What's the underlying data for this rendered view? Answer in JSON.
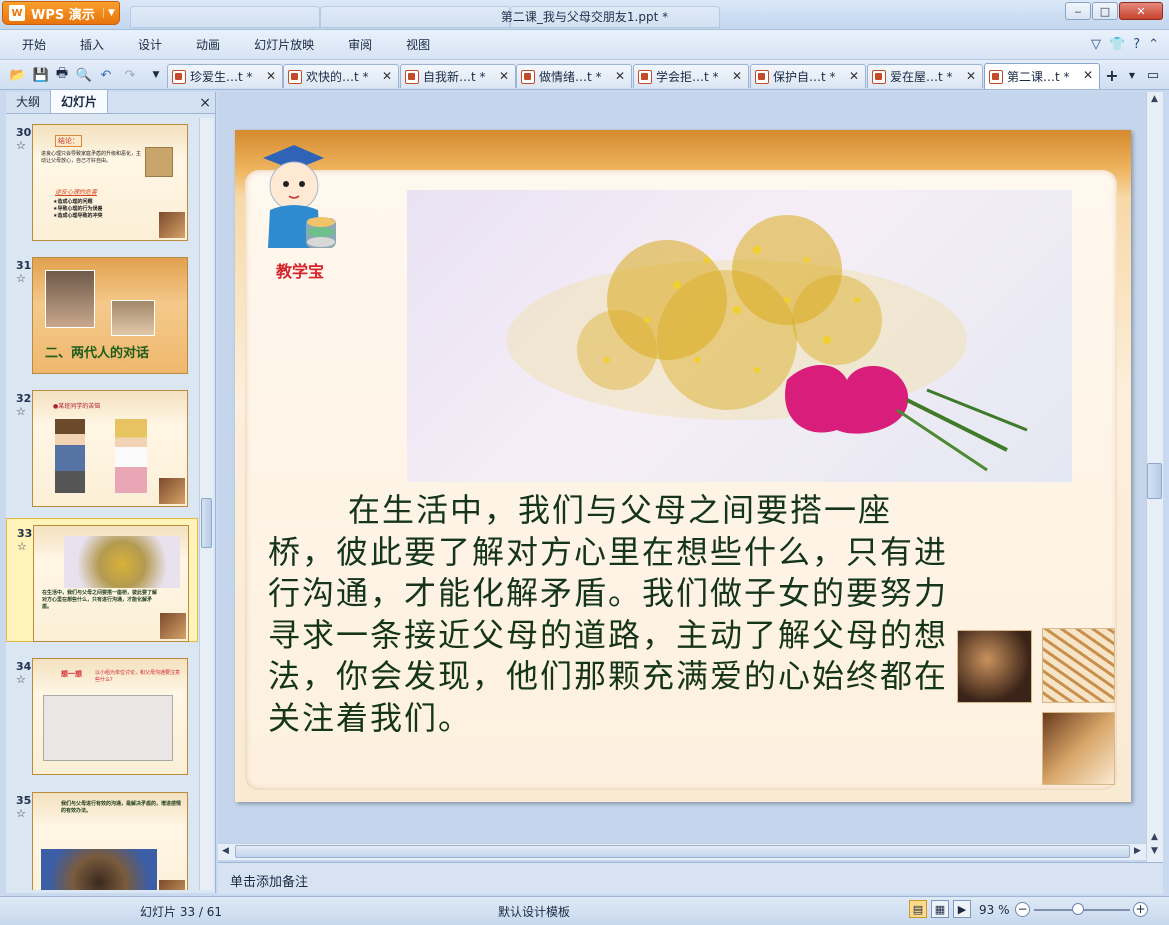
{
  "app": {
    "name": "WPS 演示",
    "document_title": "第二课_我与父母交朋友1.ppt *"
  },
  "menu": [
    "开始",
    "插入",
    "设计",
    "动画",
    "幻灯片放映",
    "审阅",
    "视图"
  ],
  "doc_tabs": [
    {
      "label": "珍爱生…t *",
      "active": false
    },
    {
      "label": "欢快的…t *",
      "active": false
    },
    {
      "label": "自我新…t *",
      "active": false
    },
    {
      "label": "做情绪…t *",
      "active": false
    },
    {
      "label": "学会拒…t *",
      "active": false
    },
    {
      "label": "保护自…t *",
      "active": false
    },
    {
      "label": "爱在屋…t *",
      "active": false
    },
    {
      "label": "第二课…t *",
      "active": true
    }
  ],
  "pane": {
    "tab_outline": "大纲",
    "tab_slides": "幻灯片",
    "close": "×"
  },
  "thumbnails": [
    {
      "num": "30",
      "star": "☆",
      "title": "结论：",
      "text": "进良心理只会导致家庭矛盾的升级和恶化，主动让父母放心，自己才好自由。",
      "sub": "逆反心理的危害",
      "bullets": [
        "★造成心理的问题",
        "★导致心理的行为误差",
        "★造成心理导致的冲突"
      ]
    },
    {
      "num": "31",
      "star": "☆",
      "title": "二、两代人的对话"
    },
    {
      "num": "32",
      "star": "☆",
      "title": "●某班同学的苦恼"
    },
    {
      "num": "33",
      "star": "☆",
      "text": "在生活中，我们与父母之间要搭一座桥，彼此要了解对方心里在想些什么，只有进行沟通，才能化解矛盾。"
    },
    {
      "num": "34",
      "star": "☆",
      "title": "想一想",
      "text": "以小组为单位讨论，和父母沟通要注意些什么？"
    },
    {
      "num": "35",
      "star": "☆",
      "text": "我们与父母进行有效的沟通，是解决矛盾的，增进感情的有效办法。"
    }
  ],
  "slide": {
    "mascot_label": "教学宝",
    "body": "在生活中，我们与父母之间要搭一座桥，彼此要了解对方心里在想些什么，只有进行沟通，才能化解矛盾。我们做子女的要努力寻求一条接近父母的道路，主动了解父母的想法，你会发现，他们那颗充满爱的心始终都在关注着我们。"
  },
  "notes_placeholder": "单击添加备注",
  "status": {
    "slide_counter": "幻灯片 33 / 61",
    "template": "默认设计模板",
    "zoom": "93 %"
  },
  "colors": {
    "accent_orange": "#e8740c",
    "slide_text": "#14351a",
    "mascot_red": "#d5242b"
  }
}
